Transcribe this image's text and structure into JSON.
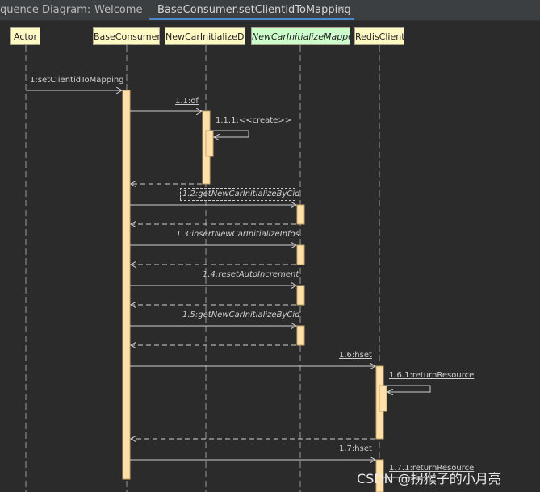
{
  "tabs": {
    "label_diagram": "quence Diagram:",
    "welcome": "Welcome",
    "active": "BaseConsumer.setClientidToMapping"
  },
  "participants": [
    {
      "name": "Actor",
      "kind": "actor"
    },
    {
      "name": "BaseConsumer",
      "kind": "class"
    },
    {
      "name": "NewCarInitializeDO",
      "kind": "class"
    },
    {
      "name": "NewCarInitializeMapper",
      "kind": "interface"
    },
    {
      "name": "RedisClient",
      "kind": "class"
    }
  ],
  "messages": [
    {
      "label": "1:setClientidToMapping",
      "from": "Actor",
      "to": "BaseConsumer"
    },
    {
      "label": "1.1:of",
      "from": "BaseConsumer",
      "to": "NewCarInitializeDO"
    },
    {
      "label": "1.1.1:<<create>>",
      "from": "NewCarInitializeDO",
      "to": "NewCarInitializeDO"
    },
    {
      "label": "1.2:getNewCarInitializeByCid",
      "from": "BaseConsumer",
      "to": "NewCarInitializeMapper"
    },
    {
      "label": "1.3:insertNewCarInitializeInfos",
      "from": "BaseConsumer",
      "to": "NewCarInitializeMapper"
    },
    {
      "label": "1.4:resetAutoIncrement",
      "from": "BaseConsumer",
      "to": "NewCarInitializeMapper"
    },
    {
      "label": "1.5:getNewCarInitializeByCid",
      "from": "BaseConsumer",
      "to": "NewCarInitializeMapper"
    },
    {
      "label": "1.6:hset",
      "from": "BaseConsumer",
      "to": "RedisClient"
    },
    {
      "label": "1.6.1:returnResource",
      "from": "RedisClient",
      "to": "RedisClient"
    },
    {
      "label": "1.7:hset",
      "from": "BaseConsumer",
      "to": "RedisClient"
    },
    {
      "label": "1.7.1:returnResource",
      "from": "RedisClient",
      "to": "RedisClient"
    }
  ],
  "watermark": "CSDN @拐猴子的小月亮",
  "colors": {
    "background": "#2b2b2b",
    "lifeline": "#cfcfcf",
    "activation": "#ffe0a8",
    "tab_accent": "#4a88c7"
  }
}
